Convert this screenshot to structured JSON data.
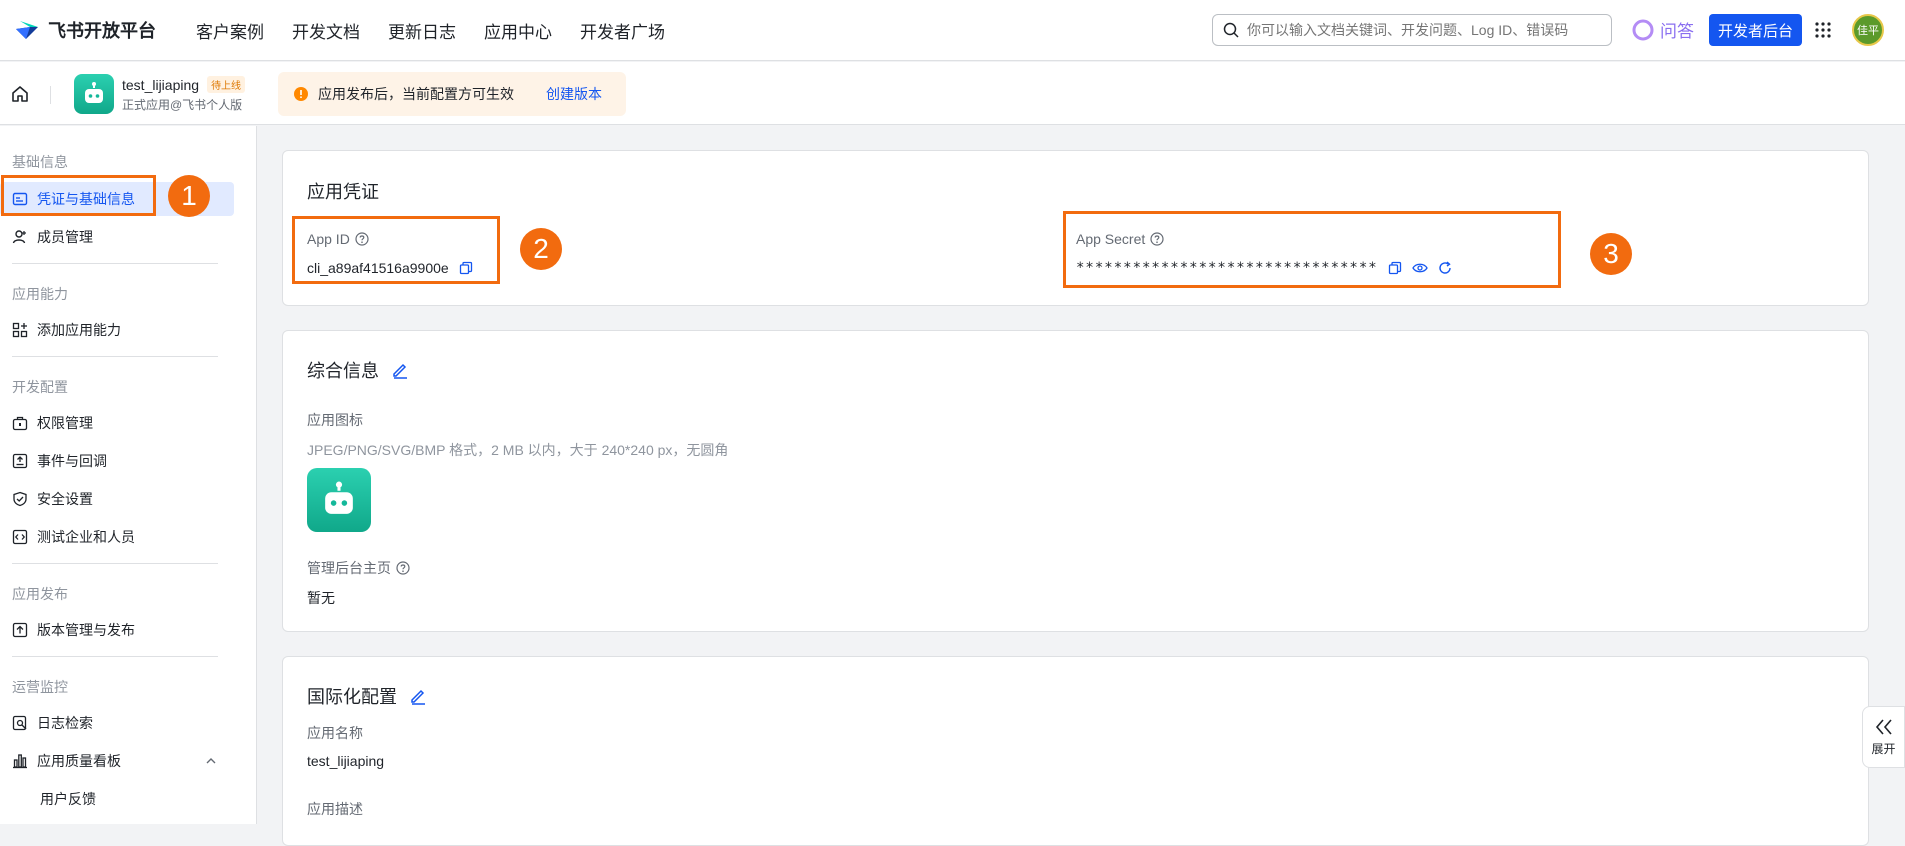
{
  "brand": {
    "name": "飞书开放平台"
  },
  "nav": {
    "links": [
      "客户案例",
      "开发文档",
      "更新日志",
      "应用中心",
      "开发者广场"
    ]
  },
  "search": {
    "placeholder": "你可以输入文档关键词、开发问题、Log ID、错误码"
  },
  "qa_label": "问答",
  "dev_console": "开发者后台",
  "user": {
    "avatar_text": "佳平"
  },
  "app": {
    "name": "test_lijiaping",
    "status": "待上线",
    "subtitle": "正式应用@飞书个人版"
  },
  "notice": {
    "text": "应用发布后，当前配置方可生效",
    "link": "创建版本"
  },
  "sidebar": {
    "groups": [
      {
        "title": "基础信息",
        "items": [
          {
            "label": "凭证与基础信息",
            "active": true
          },
          {
            "label": "成员管理"
          }
        ]
      },
      {
        "title": "应用能力",
        "items": [
          {
            "label": "添加应用能力"
          }
        ]
      },
      {
        "title": "开发配置",
        "items": [
          {
            "label": "权限管理"
          },
          {
            "label": "事件与回调"
          },
          {
            "label": "安全设置"
          },
          {
            "label": "测试企业和人员"
          }
        ]
      },
      {
        "title": "应用发布",
        "items": [
          {
            "label": "版本管理与发布"
          }
        ]
      },
      {
        "title": "运营监控",
        "items": [
          {
            "label": "日志检索"
          },
          {
            "label": "应用质量看板"
          },
          {
            "label": "用户反馈"
          }
        ]
      }
    ]
  },
  "credentials": {
    "title": "应用凭证",
    "app_id_label": "App ID",
    "app_id": "cli_a89af41516a9900e",
    "app_secret_label": "App Secret",
    "app_secret": "********************************"
  },
  "general": {
    "title": "综合信息",
    "icon_label": "应用图标",
    "icon_hint": "JPEG/PNG/SVG/BMP 格式，2 MB 以内，大于 240*240 px，无圆角",
    "homepage_label": "管理后台主页",
    "homepage_value": "暂无"
  },
  "i18n": {
    "title": "国际化配置",
    "name_label": "应用名称",
    "name_value": "test_lijiaping",
    "desc_label": "应用描述"
  },
  "annotations": [
    "1",
    "2",
    "3"
  ],
  "expand_label": "展开",
  "colors": {
    "primary": "#1456f0",
    "highlight": "#f26b0f",
    "teal": "#14b89a"
  }
}
